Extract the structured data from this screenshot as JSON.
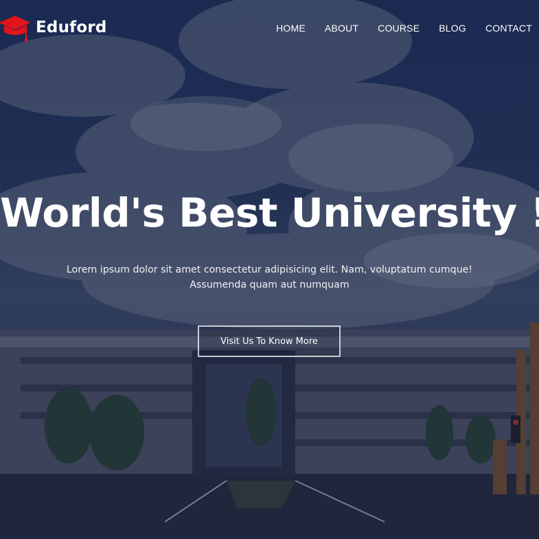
{
  "brand": {
    "name": "Eduford",
    "logo_icon": "graduation-cap-icon",
    "accent": "#e3141a"
  },
  "nav": {
    "items": [
      {
        "label": "HOME"
      },
      {
        "label": "ABOUT"
      },
      {
        "label": "COURSE"
      },
      {
        "label": "BLOG"
      },
      {
        "label": "CONTACT"
      }
    ]
  },
  "hero": {
    "title": "World's Best University !",
    "subtitle_line1": "Lorem ipsum dolor sit amet consectetur adipisicing elit. Nam, voluptatum cumque!",
    "subtitle_line2": "Assumenda quam aut numquam",
    "cta_label": "Visit Us To Know More",
    "overlay_color": "#141c3c"
  }
}
